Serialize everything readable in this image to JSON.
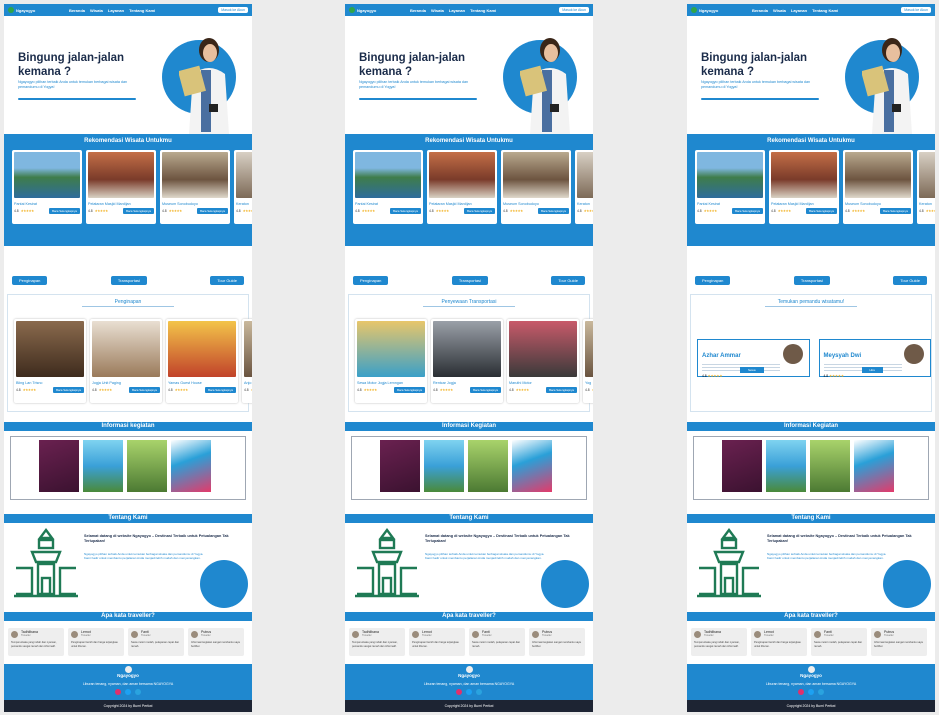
{
  "nav": {
    "brand": "Ngayogyo",
    "links": [
      "Beranda",
      "Wisata",
      "Layanan",
      "Tentang Kami"
    ],
    "login": "Masuk ke Akun"
  },
  "hero": {
    "title": "Bingung jalan-jalan kemana ?",
    "subtitle": "Ngayogyo pilihan terbaik Anda untuk temukan berbagai wisata dan pemandumu di Yogya!"
  },
  "rekomendasi": {
    "heading": "Rekomendasi Wisata Untukmu",
    "button": "Baca Selengkapnya",
    "items": [
      {
        "name": "Pantai Kesirat",
        "rating": "4.8",
        "stars": "★★★★★"
      },
      {
        "name": "Pelataran Masjid Mardijan",
        "rating": "4.8",
        "stars": "★★★★★"
      },
      {
        "name": "Museum Sonobudoyo",
        "rating": "4.8",
        "stars": "★★★★★"
      },
      {
        "name": "Keraton",
        "rating": "4.8",
        "stars": "★★★★★"
      }
    ]
  },
  "tabs": [
    "Penginapan",
    "Transportasi",
    "Tour Guide"
  ],
  "pages": [
    {
      "box_title": "Penginapan",
      "items": [
        {
          "name": "Bling Lan Trisno",
          "rating": "4.8",
          "stars": "★★★★★"
        },
        {
          "name": "Jogja Unit Paging",
          "rating": "4.8",
          "stars": "★★★★★"
        },
        {
          "name": "Yamas Guest House",
          "rating": "4.8",
          "stars": "★★★★★"
        },
        {
          "name": "Anjo",
          "rating": "4.8",
          "stars": "★★★★★"
        }
      ]
    },
    {
      "box_title": "Penyewaan Transportasi",
      "items": [
        {
          "name": "Sewa Motor Jogja Lemngan",
          "rating": "4.8",
          "stars": "★★★★★"
        },
        {
          "name": "Rentcar Jogja",
          "rating": "4.8",
          "stars": "★★★★★"
        },
        {
          "name": "Maruthi Motor",
          "rating": "4.8",
          "stars": "★★★★★"
        },
        {
          "name": "Yog",
          "rating": "4.8",
          "stars": "★★★★★"
        }
      ]
    },
    {
      "box_title": "Temukan pemandu wisatamu!",
      "guides": [
        {
          "name": "Azhar Ammar",
          "rating": "4.8",
          "stars": "★★★★★",
          "button": "Sewa"
        },
        {
          "name": "Meysyah Dwi",
          "rating": "4.8",
          "stars": "★★★★★",
          "button": "Hire"
        }
      ]
    }
  ],
  "informasi": {
    "headings": [
      "Informasi kegiatan",
      "Informasi  Kegiatan",
      "Informasi Kegiatan"
    ]
  },
  "tentang": {
    "heading": "Tentang Kami",
    "title": "Selamat datang di website Ngayogyo – Destinasi Terbaik untuk Petualangan Tak Terlupakan!",
    "text": "Ngayogyo pilihan terbaik Anda untuk temukan berbagai wisata dan pemandumu di Yogya. Kami hadir untuk membantu perjalanan Anda menjadi lebih mudah dan menyenangkan."
  },
  "testimoni": {
    "heading": "Apa kata traveller?",
    "items": [
      {
        "name": "Tadhilbana",
        "role": "Traveller",
        "text": "Tempat wisata yang indah dan nyaman, pemandu sangat ramah dan informatif."
      },
      {
        "name": "Lemot",
        "role": "Traveller",
        "text": "Penginapan bersih dan harga terjangkau untuk liburan."
      },
      {
        "name": "Fanti",
        "role": "Traveller",
        "text": "Sewa motor mudah, pelayanan cepat dan ramah."
      },
      {
        "name": "Putrus",
        "role": "Traveller",
        "text": "Informasi kegiatan sangat membantu saya berlibur."
      }
    ]
  },
  "footer": {
    "brand": "Ngayogyo",
    "tagline": "Liburan tenang, nyaman, dan aman bersama NGAYOGYA",
    "copyright": "Copyright 2024 by Bumi Pertiwi"
  }
}
